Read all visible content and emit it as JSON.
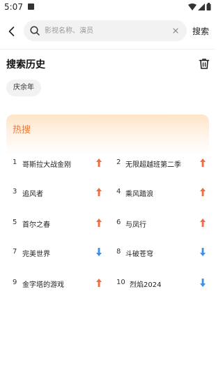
{
  "status_bar": {
    "time": "5:07",
    "icons": [
      "app-notification-icon",
      "wifi-icon",
      "signal-icon",
      "battery-icon"
    ]
  },
  "search": {
    "placeholder": "影视名称、演员",
    "value": "",
    "submit_label": "搜索"
  },
  "history": {
    "title": "搜索历史",
    "items": [
      "庆余年"
    ]
  },
  "hot": {
    "title": "热搜",
    "items": [
      {
        "rank": "1",
        "name": "哥斯拉大战金刚",
        "trend": "up"
      },
      {
        "rank": "2",
        "name": "无限超越班第二季",
        "trend": "up"
      },
      {
        "rank": "3",
        "name": "追风者",
        "trend": "up"
      },
      {
        "rank": "4",
        "name": "乘风踏浪",
        "trend": "up"
      },
      {
        "rank": "5",
        "name": "首尔之春",
        "trend": "up"
      },
      {
        "rank": "6",
        "name": "与凤行",
        "trend": "up"
      },
      {
        "rank": "7",
        "name": "完美世界",
        "trend": "down"
      },
      {
        "rank": "8",
        "name": "斗破苍穹",
        "trend": "down"
      },
      {
        "rank": "9",
        "name": "金字塔的游戏",
        "trend": "up"
      },
      {
        "rank": "10",
        "name": "烈焰2024",
        "trend": "down"
      }
    ]
  },
  "colors": {
    "accent": "#f07a35",
    "trend_up": "#f26a3d",
    "trend_down": "#3d8ee6"
  }
}
